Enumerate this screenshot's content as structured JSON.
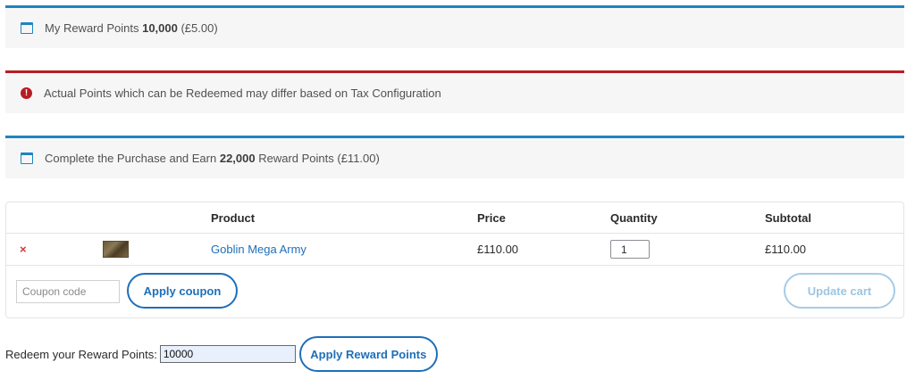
{
  "notices": {
    "my_points": {
      "icon": "window-icon",
      "prefix": "My Reward Points ",
      "points": "10,000",
      "suffix": " (£5.00)"
    },
    "tax_warning": {
      "icon": "error-icon",
      "text": "Actual Points which can be Redeemed may differ based on Tax Configuration",
      "color": "#b81c23"
    },
    "earn_points": {
      "icon": "window-icon",
      "prefix": "Complete the Purchase and Earn ",
      "points": "22,000",
      "suffix": " Reward Points (£11.00)"
    }
  },
  "cart": {
    "headers": {
      "product": "Product",
      "price": "Price",
      "quantity": "Quantity",
      "subtotal": "Subtotal"
    },
    "items": [
      {
        "remove": "×",
        "name": "Goblin Mega Army",
        "price": "£110.00",
        "quantity": "1",
        "subtotal": "£110.00"
      }
    ],
    "coupon_placeholder": "Coupon code",
    "apply_coupon_label": "Apply coupon",
    "update_cart_label": "Update cart"
  },
  "redeem": {
    "label": "Redeem your Reward Points:",
    "value": "10000",
    "apply_label": "Apply Reward Points"
  },
  "colors": {
    "accent": "#1e85be",
    "link": "#1e6fb8",
    "error": "#b81c23",
    "remove": "#d63638"
  }
}
